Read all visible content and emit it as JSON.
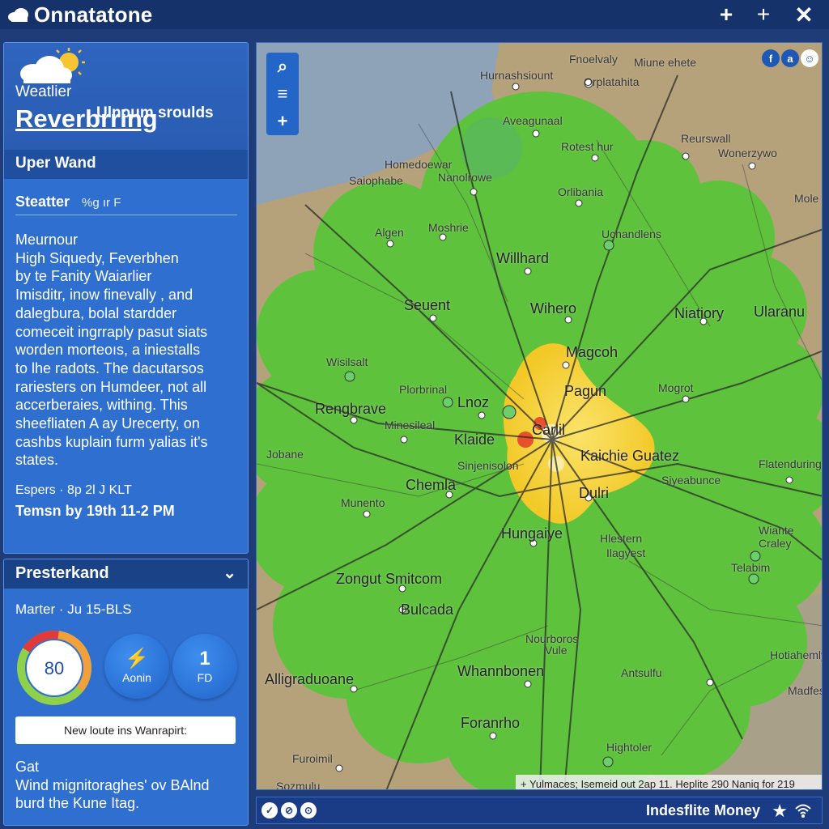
{
  "titlebar": {
    "title": "Onnatatone",
    "plus_a": "+",
    "plus_b": "+",
    "close": "✕"
  },
  "sidebar": {
    "header_subtitle": "Ulnoum sroulds",
    "weather_label": "Weatlier",
    "header_link": "Reverbrring",
    "section_title": "Uper Wand",
    "stat_label": "Steatter",
    "stat_value": "%g ır F",
    "body_lines": [
      "Meurnour",
      "High Siquedy,   Feverbhen",
      "by te Fanity Waiarlier",
      "Imisditr, inow finevally , and",
      "dalegbura, bolal stardder",
      "comeceit ingrraply pasut siats",
      "worden morteoıs, a iniestalls",
      "to lhe radots. The dacutarsos",
      "rariesters on Humdeer, not all",
      "accerberaies, withing. This",
      "sheefliaten A ay Urecerty, on",
      "cashbs kuplain furm yalias it's",
      "states."
    ],
    "meta_line": "Espers · 8p 2l J KLT",
    "time_line": "Temsn by 19th 11-2 PM"
  },
  "bottom_panel": {
    "title": "Presterkand",
    "chevron": "⌄",
    "date_line": "Marter · Ju 15-BLS",
    "gauge_value": "80",
    "gauge_fraction": 0.8,
    "btn_admin_big": "⚡",
    "btn_admin_small": "Aonin",
    "btn_fd_big": "1",
    "btn_fd_small": "FD",
    "route_text": "New loute ins Wanrapirt:",
    "gat_label": "Gat",
    "wind_text": "Wind mignitoraghes' ov BAlnd burd the Kune Itag."
  },
  "map": {
    "zoom_search": "⌕",
    "zoom_layer": "≡",
    "zoom_plus": "+",
    "social_f": "f",
    "social_a": "a",
    "social_c": "☺",
    "cities": {
      "c1": "Fnoelvaly",
      "c2": "Miune ehete",
      "c3": "Hurnashsiount",
      "c4": "Orplatahita",
      "c5": "Aveagunaal",
      "c6": "Rotest hur",
      "c7": "Reurswall",
      "c8": "Homedoewar",
      "c9": "Saiophabe",
      "c10": "Nanolrowe",
      "c11": "Wonerzywo",
      "c12": "Orlibania",
      "c13": "Mole",
      "c14": "Algen",
      "c15": "Moshrie",
      "c16": "Uchandlens",
      "c17": "Willhard",
      "c18": "Seuent",
      "c19": "Wihero",
      "c20": "Niatiory",
      "c21": "Ularanu",
      "c22": "Magcoh",
      "c23": "Wisilsalt",
      "c24": "Pagun",
      "c25": "Plorbrinal",
      "c26": "Lnoz",
      "c27": "Mogrot",
      "c28": "Rengbrave",
      "c29": "Minesileal",
      "c30": "Carlil",
      "c31": "Klaide",
      "c32": "Kaichie Guatez",
      "c33": "Jobane",
      "c34": "Sinjenisolon",
      "c35": "Flatenduring",
      "c36": "Chemla",
      "c37": "Siyeabunce",
      "c38": "Munento",
      "c39": "Dulri",
      "c40": "Hungaiye",
      "c41": "Hlestern",
      "c42": "Wiante",
      "c43": "Craley",
      "c44": "Ilagyest",
      "c45": "Telabim",
      "c46": "Zongut Smitcom",
      "c47": "Bulcada",
      "c48": "Nourboros",
      "c49": "Vule",
      "c50": "Whannbonen",
      "c51": "Antsulfu",
      "c52": "Alligraduoane",
      "c53": "Hotiahemly",
      "c54": "Madfes",
      "c55": "Foranrho",
      "c56": "Hightoler",
      "c57": "Furoimil",
      "c58": "Sozmulu"
    },
    "status_text": "+  Yulmaces; Isemeid out 2ap 11. Heplite 290 Naniq for 219"
  },
  "footer": {
    "icon1": "✓",
    "icon2": "⊘",
    "icon3": "⊙",
    "label": "Indesflite Money",
    "star": "★"
  },
  "colors": {
    "background": "#1e3c78",
    "panel": "#2e6fd0",
    "titlebar": "#16326a",
    "radar_green": "#5cc43a",
    "radar_yellow": "#f2c928",
    "radar_red": "#e8502c",
    "gauge_green": "#8fd14a",
    "gauge_orange": "#f2a13a",
    "gauge_red": "#e23a3a"
  }
}
